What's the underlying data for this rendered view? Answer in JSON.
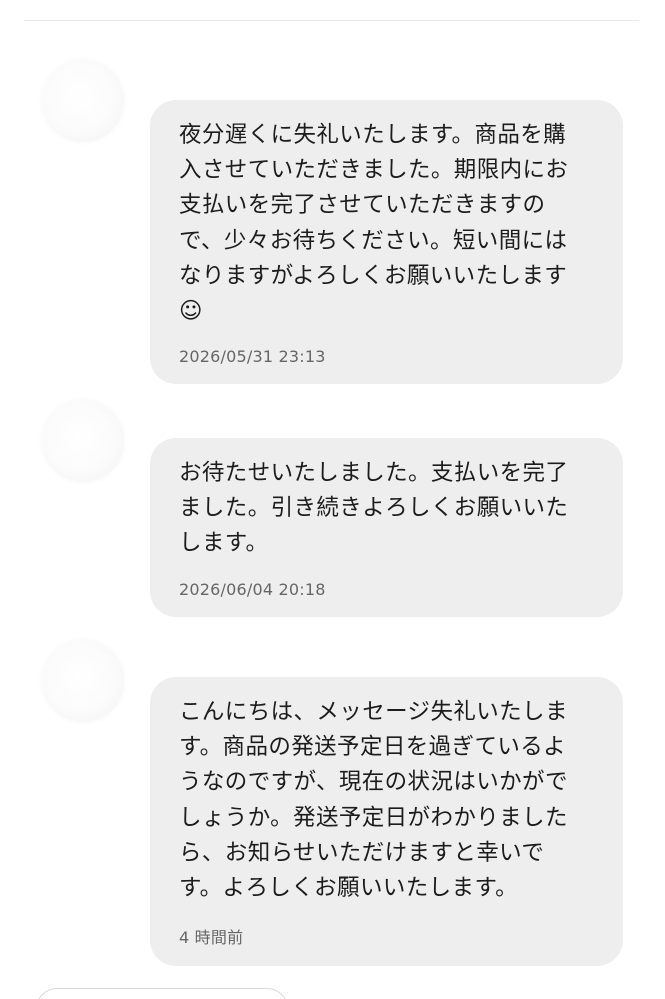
{
  "messages": [
    {
      "text": "夜分遅くに失礼いたします。商品を購\n入させていただきました。期限内にお\n支払いを完了させていただきますの\nで、少々お待ちください。短い間には\nなりますがよろしくお願いいたします\n☺",
      "time": "2026/05/31 23:13"
    },
    {
      "text": "お待たせいたしました。支払いを完了\nました。引き続きよろしくお願いいた\nします。",
      "time": "2026/06/04 20:18"
    },
    {
      "text": "こんにちは、メッセージ失礼いたしま\nす。商品の発送予定日を過ぎているよ\nうなのですが、現在の状況はいかがで\nしょうか。発送予定日がわかりました\nら、お知らせいただけますと幸いで\nす。よろしくお願いいたします。",
      "time": "4 時間前"
    }
  ]
}
